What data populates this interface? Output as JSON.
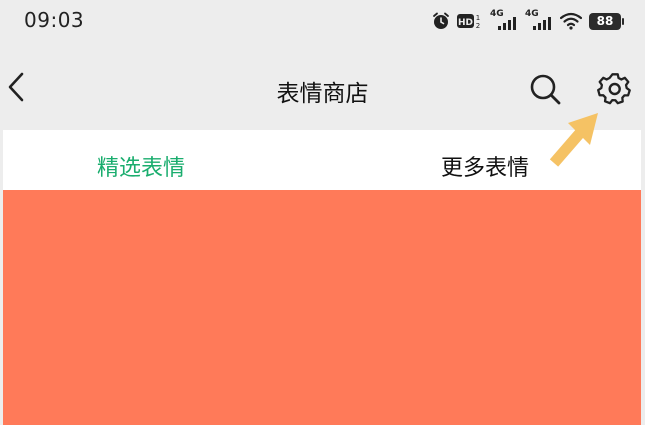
{
  "status_bar": {
    "time": "09:03",
    "signal_label_1": "4G",
    "signal_label_2": "4G",
    "battery": "88",
    "icons": [
      "alarm-icon",
      "hd-icon",
      "signal-icon",
      "signal-icon",
      "wifi-icon",
      "battery-icon"
    ]
  },
  "nav": {
    "title": "表情商店",
    "back_icon": "chevron-left-icon",
    "search_icon": "search-icon",
    "settings_icon": "gear-icon"
  },
  "tabs": [
    {
      "label": "精选表情",
      "active": true
    },
    {
      "label": "更多表情",
      "active": false
    }
  ],
  "colors": {
    "accent": "#1aad6e",
    "banner": "#ff7a59",
    "annotation_arrow": "#f5c264",
    "nav_bg": "#ededed"
  }
}
